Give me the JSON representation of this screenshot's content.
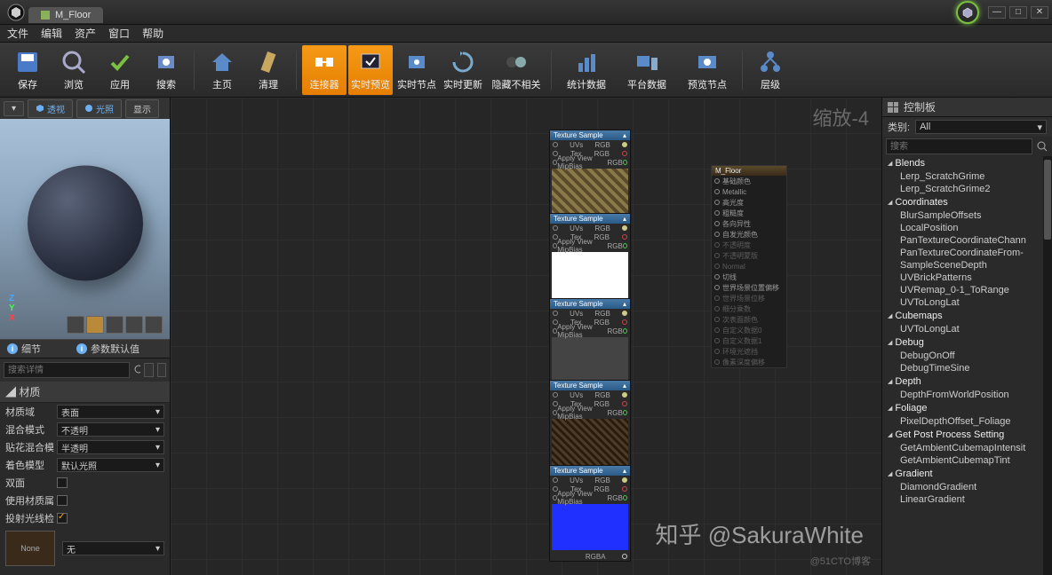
{
  "title": "M_Floor",
  "menu": [
    "文件",
    "编辑",
    "资产",
    "窗口",
    "帮助"
  ],
  "toolbar": [
    {
      "label": "保存",
      "icon": "save"
    },
    {
      "label": "浏览",
      "icon": "browse"
    },
    {
      "label": "应用",
      "icon": "apply"
    },
    {
      "label": "搜索",
      "icon": "search"
    },
    {
      "label": "主页",
      "icon": "home"
    },
    {
      "label": "清理",
      "icon": "clean"
    },
    {
      "label": "连接器",
      "icon": "connector",
      "active": true
    },
    {
      "label": "实时预览",
      "icon": "live",
      "active": true
    },
    {
      "label": "实时节点",
      "icon": "livenode"
    },
    {
      "label": "实时更新",
      "icon": "liveupdate"
    },
    {
      "label": "隐藏不相关",
      "icon": "hide",
      "wide": true
    },
    {
      "label": "统计数据",
      "icon": "stats",
      "wide": true
    },
    {
      "label": "平台数据",
      "icon": "platform",
      "wide": true
    },
    {
      "label": "预览节点",
      "icon": "previewnode",
      "wide": true
    },
    {
      "label": "层级",
      "icon": "hierarchy"
    }
  ],
  "viewport_toolbar": {
    "persp": "透视",
    "light": "光照",
    "show": "显示"
  },
  "left_tabs": {
    "detail": "细节",
    "default": "参数默认值"
  },
  "search_placeholder": "搜索详情",
  "material_section": "材质",
  "props": [
    {
      "label": "材质域",
      "value": "表面"
    },
    {
      "label": "混合模式",
      "value": "不透明"
    },
    {
      "label": "贴花混合模",
      "value": "半透明"
    },
    {
      "label": "着色模型",
      "value": "默认光照"
    }
  ],
  "flags": [
    {
      "label": "双面",
      "checked": false
    },
    {
      "label": "使用材质属",
      "checked": false
    },
    {
      "label": "投射光线检",
      "checked": true
    }
  ],
  "swatch": {
    "none": "None",
    "dd": "无"
  },
  "zoom": "缩放-4",
  "node_title": "Texture Sample",
  "node_rows": [
    "UVs",
    "Tex",
    "Apply View MipBias"
  ],
  "node_out": "RGB",
  "node_outa": "RGBA",
  "main_node": {
    "title": "M_Floor",
    "pins": [
      "基础颜色",
      "Metallic",
      "高光度",
      "粗糙度",
      "各向异性",
      "自发光颜色",
      "不透明度",
      "不透明蒙版",
      "Normal",
      "切线",
      "世界场景位置偏移",
      "世界场景位移",
      "细分乘数",
      "次表面颜色",
      "自定义数据0",
      "自定义数据1",
      "环境光遮挡",
      "像素深度偏移"
    ]
  },
  "right_panel": {
    "title": "控制板",
    "cat_label": "类别:",
    "cat_value": "All",
    "search": "搜索"
  },
  "palette": [
    {
      "cat": "Blends",
      "items": [
        "Lerp_ScratchGrime",
        "Lerp_ScratchGrime2"
      ]
    },
    {
      "cat": "Coordinates",
      "items": [
        "BlurSampleOffsets",
        "LocalPosition",
        "PanTextureCoordinateChann",
        "PanTextureCoordinateFrom-",
        "SampleSceneDepth",
        "UVBrickPatterns",
        "UVRemap_0-1_ToRange",
        "UVToLongLat"
      ]
    },
    {
      "cat": "Cubemaps",
      "items": [
        "UVToLongLat"
      ]
    },
    {
      "cat": "Debug",
      "items": [
        "DebugOnOff",
        "DebugTimeSine"
      ]
    },
    {
      "cat": "Depth",
      "items": [
        "DepthFromWorldPosition"
      ]
    },
    {
      "cat": "Foliage",
      "items": [
        "PixelDepthOffset_Foliage"
      ]
    },
    {
      "cat": "Get Post Process Setting",
      "items": [
        "GetAmbientCubemapIntensit",
        "GetAmbientCubemapTint"
      ]
    },
    {
      "cat": "Gradient",
      "items": [
        "DiamondGradient",
        "LinearGradient"
      ]
    }
  ],
  "watermark": "知乎 @SakuraWhite",
  "watermark2": "@51CTO博客"
}
